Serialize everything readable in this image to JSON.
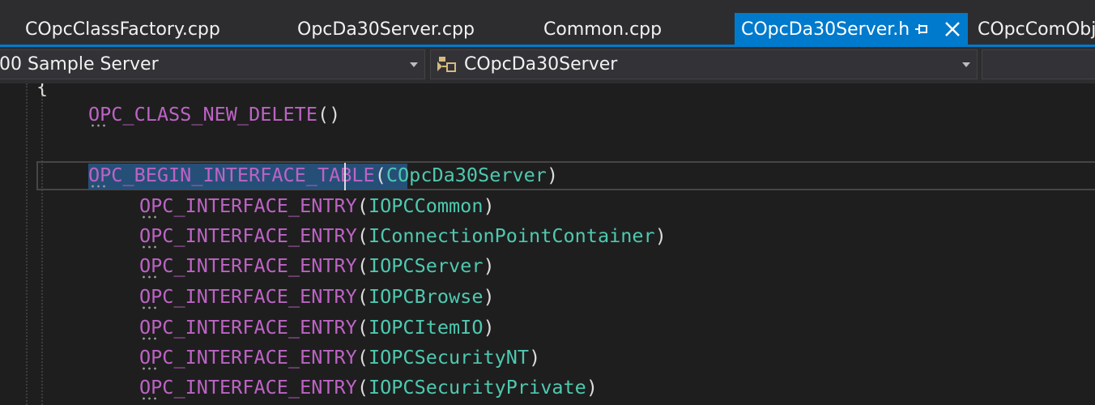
{
  "tabs": [
    {
      "label": "COpcClassFactory.cpp",
      "active": false
    },
    {
      "label": "OpcDa30Server.cpp",
      "active": false
    },
    {
      "label": "Common.cpp",
      "active": false
    },
    {
      "label": "COpcDa30Server.h",
      "active": true
    },
    {
      "label": "COpcComObj",
      "active": false
    }
  ],
  "navbar": {
    "project_combo": "00 Sample Server",
    "class_combo": "COpcDa30Server",
    "class_icon": "class-icon",
    "dropdown_icon": "chevron-down-icon"
  },
  "editor": {
    "brace": "{",
    "lines": [
      {
        "macro": "OPC_CLASS_NEW_DELETE",
        "open": "(",
        "arg": "",
        "close": ")"
      },
      {
        "macro": "OPC_BEGIN_INTERFACE_TABLE",
        "open": "(",
        "arg": "COpcDa30Server",
        "close": ")"
      },
      {
        "macro": "OPC_INTERFACE_ENTRY",
        "open": "(",
        "arg": "IOPCCommon",
        "close": ")"
      },
      {
        "macro": "OPC_INTERFACE_ENTRY",
        "open": "(",
        "arg": "IConnectionPointContainer",
        "close": ")"
      },
      {
        "macro": "OPC_INTERFACE_ENTRY",
        "open": "(",
        "arg": "IOPCServer",
        "close": ")"
      },
      {
        "macro": "OPC_INTERFACE_ENTRY",
        "open": "(",
        "arg": "IOPCBrowse",
        "close": ")"
      },
      {
        "macro": "OPC_INTERFACE_ENTRY",
        "open": "(",
        "arg": "IOPCItemIO",
        "close": ")"
      },
      {
        "macro": "OPC_INTERFACE_ENTRY",
        "open": "(",
        "arg": "IOPCSecurityNT",
        "close": ")"
      },
      {
        "macro": "OPC_INTERFACE_ENTRY",
        "open": "(",
        "arg": "IOPCSecurityPrivate",
        "close": ")"
      }
    ],
    "selected_text": "OPC_BEGIN_INTERFACE_TABLE"
  },
  "colors": {
    "background": "#1e1e1e",
    "accent": "#007acc",
    "macro": "#bd63c5",
    "type": "#4ec9b0",
    "text": "#dcdcdc",
    "selection": "#264f78"
  }
}
